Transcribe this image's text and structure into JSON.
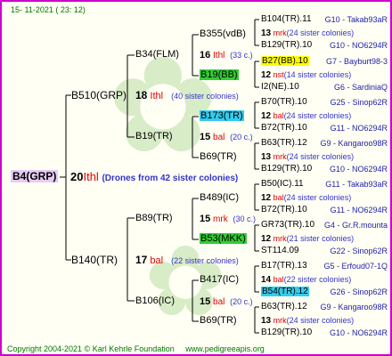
{
  "header": "15- 11-2021 ( 23: 12)",
  "footer": {
    "copyright": "Copyright 2004-2021 © Karl Kehrle Foundation",
    "url": "www.pedigreeapis.org"
  },
  "root": {
    "name": "B4(GRP)",
    "num": "20",
    "code": "Ithl",
    "comment": "(Drones from 42 sister colonies)"
  },
  "gen1": [
    {
      "name": "B510(GRP)",
      "num": "18",
      "code": "Ithl",
      "comment": "(40 sister colonies)"
    },
    {
      "name": "B140(TR)",
      "num": "17",
      "code": "bal",
      "comment": "(22 sister colonies)"
    }
  ],
  "gen2": [
    {
      "name": "B34(FLM)",
      "num": "16",
      "code": "Ithl",
      "comment": "(33 c.)"
    },
    {
      "name": "B19(TR)",
      "num": "15",
      "code": "bal",
      "comment": "(20 c.)"
    },
    {
      "name": "B89(TR)",
      "num": "15",
      "code": "mrk",
      "comment": "(30 c.)"
    },
    {
      "name": "B106(IC)",
      "num": "15",
      "code": "bal",
      "comment": "(20 c.)"
    }
  ],
  "gen3": [
    {
      "name": "B355(vdB)",
      "num": "13",
      "code": "mrk",
      "comment": "(24 sister colonies)"
    },
    {
      "name": "B19(BB)",
      "num": "12",
      "code": "nst",
      "comment": "(14 sister colonies)"
    },
    {
      "name": "B173(TR)",
      "num": "12",
      "code": "bal",
      "comment": "(24 sister colonies)"
    },
    {
      "name": "B69(TR)",
      "num": "13",
      "code": "mrk",
      "comment": "(24 sister colonies)"
    },
    {
      "name": "B489(IC)",
      "num": "12",
      "code": "bal",
      "comment": "(24 sister colonies)"
    },
    {
      "name": "B53(MKK)",
      "num": "12",
      "code": "mrk",
      "comment": "(21 sister colonies)"
    },
    {
      "name": "B417(IC)",
      "num": "14",
      "code": "bal",
      "comment": "(22 sister colonies)"
    },
    {
      "name": "B69(TR)",
      "num": "13",
      "code": "mrk",
      "comment": "(24 sister colonies)"
    }
  ],
  "gen4": [
    {
      "name": "B104(TR).11",
      "loc": "G10 - Takab93aR"
    },
    {
      "name": "B129(TR).10",
      "loc": "G10 - NO6294R"
    },
    {
      "name": "B27(BB).10",
      "loc": "G7 - Bayburt98-3"
    },
    {
      "name": "I2(NE).10",
      "loc": "G6 - SardiniaQ"
    },
    {
      "name": "B70(TR).10",
      "loc": "G25 - Sinop62R"
    },
    {
      "name": "B72(TR).10",
      "loc": "G11 - NO6294R"
    },
    {
      "name": "B63(TR).12",
      "loc": "G9 - Kangaroo98R"
    },
    {
      "name": "B129(TR).10",
      "loc": "G10 - NO6294R"
    },
    {
      "name": "B50(IC).11",
      "loc": "G11 - Takab93aR"
    },
    {
      "name": "B72(TR).10",
      "loc": "G11 - NO6294R"
    },
    {
      "name": "GR73(TR).10",
      "loc": "G4 - Gr.R.mounta"
    },
    {
      "name": "ST114.09",
      "loc": "G22 - Sinop62R"
    },
    {
      "name": "B17(TR).13",
      "loc": "G5 - Erfoud07-1Q"
    },
    {
      "name": "B54(TR).12",
      "loc": "G26 - Sinop62R"
    },
    {
      "name": "B63(TR).12",
      "loc": "G9 - Kangaroo98R"
    },
    {
      "name": "B129(TR).10",
      "loc": "G10 - NO6294R"
    }
  ]
}
